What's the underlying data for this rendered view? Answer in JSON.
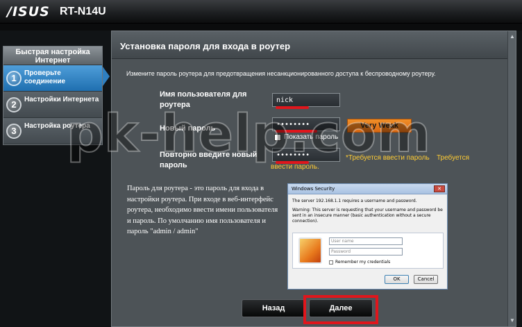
{
  "header": {
    "brand": "/ISUS",
    "model": "RT-N14U"
  },
  "nav": {
    "title": "Быстрая настройка Интернет",
    "steps": [
      {
        "num": "1",
        "label": "Проверьте соединение"
      },
      {
        "num": "2",
        "label": "Настройки Интернета"
      },
      {
        "num": "3",
        "label": "Настройка роутера"
      }
    ]
  },
  "panel": {
    "title": "Установка пароля для входа в роутер",
    "description": "Измените пароль роутера для предотвращения несанкционированного доступа к беспроводному роутеру.",
    "username_label": "Имя пользователя для роутера",
    "username_value": "nick",
    "password_label": "Новый пароль",
    "password_value": "••••••••",
    "strength": "Very Weak",
    "show_password": "Показать пароль",
    "confirm_label": "Повторно введите новый пароль",
    "confirm_value": "••••••••",
    "warning_1": "*Требуется ввести пароль",
    "warning_2": "Требуется",
    "warning_3": "ввести пароль.",
    "info": "Пароль для роутера - это пароль для входа в настройки роутера. При входе в веб-интерфейс роутера, необходимо ввести имени пользователя и пароль. По умолчанию имя пользователя и пароль \"admin / admin\""
  },
  "dialog": {
    "title": "Windows Security",
    "line1": "The server 192.168.1.1 requires a username and password.",
    "line2": "Warning: This server is requesting that your username and password be sent in an insecure manner (basic authentication without a secure connection).",
    "username_placeholder": "User name",
    "password_placeholder": "Password",
    "remember": "Remember my credentials",
    "ok": "OK",
    "cancel": "Cancel"
  },
  "buttons": {
    "back": "Назад",
    "next": "Далее"
  },
  "watermark": "pk-help.com"
}
